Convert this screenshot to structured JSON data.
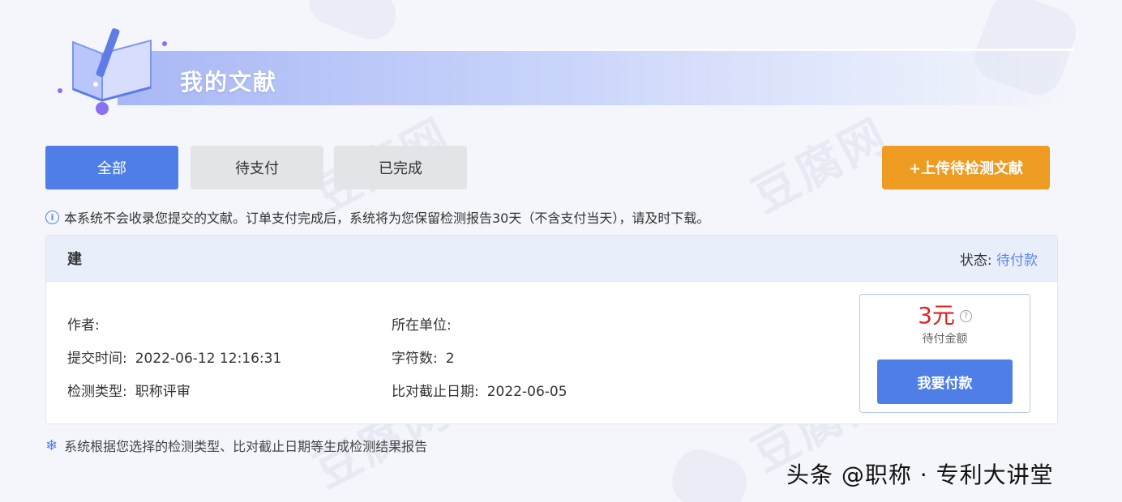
{
  "header": {
    "title": "我的文献"
  },
  "tabs": [
    {
      "label": "全部",
      "active": true
    },
    {
      "label": "待支付",
      "active": false
    },
    {
      "label": "已完成",
      "active": false
    }
  ],
  "upload_button": "+上传待检测文献",
  "notice": "本系统不会收录您提交的文献。订单支付完成后，系统将为您保留检测报告30天（不含支付当天），请及时下载。",
  "order": {
    "title": "建",
    "status_label": "状态:",
    "status_value": "待付款",
    "author_label": "作者:",
    "author_value": "",
    "org_label": "所在单位:",
    "org_value": "",
    "submit_time_label": "提交时间:",
    "submit_time_value": "2022-06-12 12:16:31",
    "char_count_label": "字符数:",
    "char_count_value": "2",
    "check_type_label": "检测类型:",
    "check_type_value": "职称评审",
    "cutoff_label": "比对截止日期:",
    "cutoff_value": "2022-06-05",
    "amount": "3元",
    "amount_label": "待付金额",
    "pay_button": "我要付款"
  },
  "footnote": "系统根据您选择的检测类型、比对截止日期等生成检测结果报告",
  "watermark_text": "豆腐网",
  "brand": "头条 @职称 · 专利大讲堂",
  "colors": {
    "primary": "#4f7fe6",
    "orange": "#ee9b22",
    "amount_red": "#e02020",
    "tab_inactive": "#e2e4e8"
  }
}
